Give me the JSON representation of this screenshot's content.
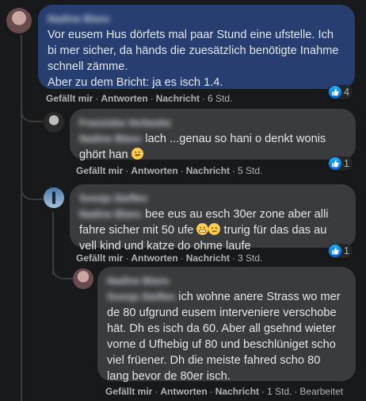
{
  "comments": [
    {
      "author": "Nadine Blanc",
      "text_lines": [
        "Vor eusem Hus dörfets mal paar Stund eine ufstelle. Ich",
        "bi mer sicher, da händs die zuesätzlich benötigte Inahme",
        "schnell zämme.",
        "Aber zu dem Bricht: ja es isch 1.4."
      ],
      "reaction_count": "4",
      "like": "Gefällt mir",
      "reply": "Antworten",
      "message": "Nachricht",
      "time": "6 Std."
    },
    {
      "author_line1": "Franziska Verbeeke",
      "mention": "Nadine Blanc",
      "text_line1": "lach ...genau so hani o denkt wonis",
      "text_line2": "ghört han",
      "reaction_count": "1",
      "like": "Gefällt mir",
      "reply": "Antworten",
      "message": "Nachricht",
      "time": "5 Std."
    },
    {
      "author_line1": "Svenja Steffen",
      "mention": "Nadine Blanc",
      "text_line1": "bee eus au esch 30er zone aber alli",
      "text_line2": "fahre sicher mit 50 ufe",
      "text_line2b": "trurig für das das au",
      "text_line3": "vell kind und katze do ohme laufe",
      "reaction_count": "1",
      "like": "Gefällt mir",
      "reply": "Antworten",
      "message": "Nachricht",
      "time": "3 Std."
    },
    {
      "author_line1": "Nadine Blanc",
      "mention": "Svenja Steffen",
      "text_line1": "ich wohne anere Strass wo mer",
      "text_lines": [
        "de 80 ufgrund eusem interveniere verschobe",
        "hät. Dh es isch da 60. Aber all gsehnd wieter",
        "vorne d Ufhebig uf 80 und beschlüniget scho",
        "viel früener. Dh die meiste fahred scho 80",
        "lang bevor de 80er isch."
      ],
      "like": "Gefällt mir",
      "reply": "Antworten",
      "message": "Nachricht",
      "time": "1 Std.",
      "edited": "Bearbeitet"
    }
  ],
  "colors": {
    "background": "#18191a",
    "main_bubble": "#263f70",
    "reply_bubble": "#3a3b3c",
    "like_blue": "#1877f2"
  }
}
